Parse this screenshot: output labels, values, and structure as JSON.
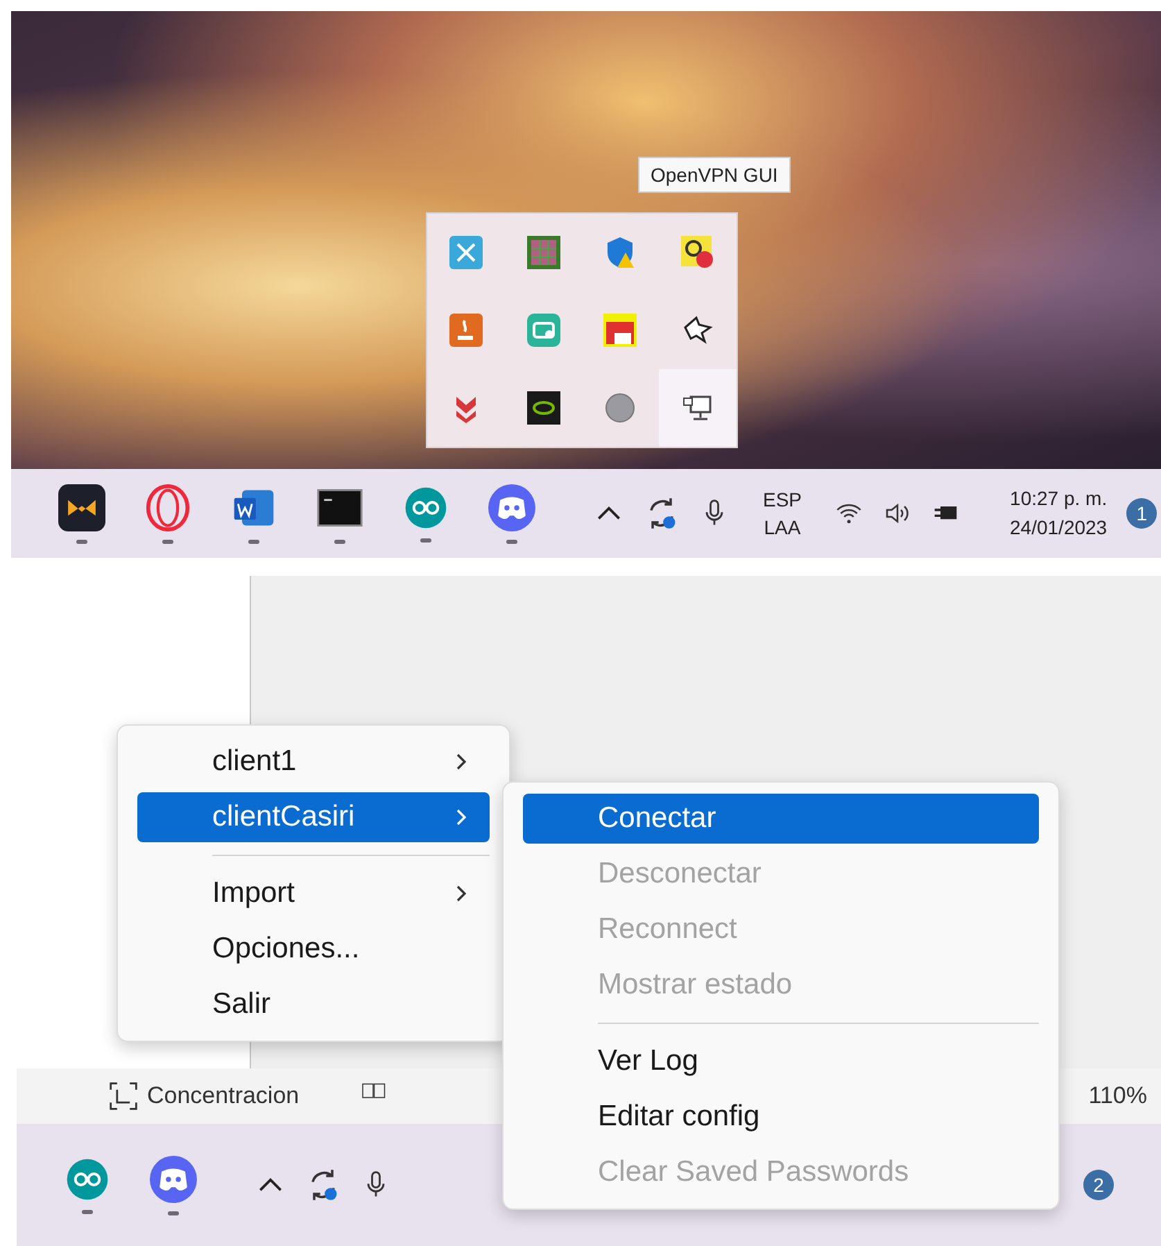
{
  "tooltip": {
    "text": "OpenVPN GUI"
  },
  "tray_flyout": {
    "icons": [
      {
        "kind": "tools",
        "selected": false
      },
      {
        "kind": "grid",
        "selected": false
      },
      {
        "kind": "shield",
        "selected": false
      },
      {
        "kind": "checklock",
        "selected": false
      },
      {
        "kind": "java",
        "selected": false
      },
      {
        "kind": "remote",
        "selected": false
      },
      {
        "kind": "chart",
        "selected": false
      },
      {
        "kind": "wolf",
        "selected": false
      },
      {
        "kind": "download",
        "selected": false
      },
      {
        "kind": "gpu",
        "selected": false
      },
      {
        "kind": "circle",
        "selected": false
      },
      {
        "kind": "network",
        "selected": true
      }
    ]
  },
  "taskbar": {
    "apps": [
      {
        "kind": "mail",
        "running": true
      },
      {
        "kind": "opera",
        "running": true
      },
      {
        "kind": "word",
        "running": true
      },
      {
        "kind": "terminal",
        "running": true
      },
      {
        "kind": "arduino",
        "running": true
      },
      {
        "kind": "discord",
        "running": true
      }
    ],
    "language": [
      "ESP",
      "LAA"
    ],
    "time": "10:27 p. m.",
    "date": "24/01/2023",
    "notifications": "1"
  },
  "status_bar": {
    "focus": "Concentracion",
    "zoom": "110%"
  },
  "taskbar_2": {
    "apps": [
      {
        "kind": "arduino",
        "running": true
      },
      {
        "kind": "discord",
        "running": true
      }
    ],
    "notifications": "2"
  },
  "menu": {
    "items": [
      {
        "kind": "item",
        "label": "client1",
        "submenu": true,
        "selected": false
      },
      {
        "kind": "item",
        "label": "clientCasiri",
        "submenu": true,
        "selected": true
      },
      {
        "kind": "separator"
      },
      {
        "kind": "item",
        "label": "Import",
        "submenu": true,
        "selected": false
      },
      {
        "kind": "item",
        "label": "Opciones...",
        "submenu": false,
        "selected": false
      },
      {
        "kind": "item",
        "label": "Salir",
        "submenu": false,
        "selected": false
      }
    ]
  },
  "submenu": {
    "items": [
      {
        "kind": "item",
        "label": "Conectar",
        "selected": true,
        "disabled": false
      },
      {
        "kind": "item",
        "label": "Desconectar",
        "selected": false,
        "disabled": true
      },
      {
        "kind": "item",
        "label": "Reconnect",
        "selected": false,
        "disabled": true
      },
      {
        "kind": "item",
        "label": "Mostrar estado",
        "selected": false,
        "disabled": true
      },
      {
        "kind": "separator"
      },
      {
        "kind": "item",
        "label": "Ver Log",
        "selected": false,
        "disabled": false
      },
      {
        "kind": "item",
        "label": "Editar config",
        "selected": false,
        "disabled": false
      },
      {
        "kind": "item",
        "label": "Clear Saved Passwords",
        "selected": false,
        "disabled": true
      }
    ]
  }
}
